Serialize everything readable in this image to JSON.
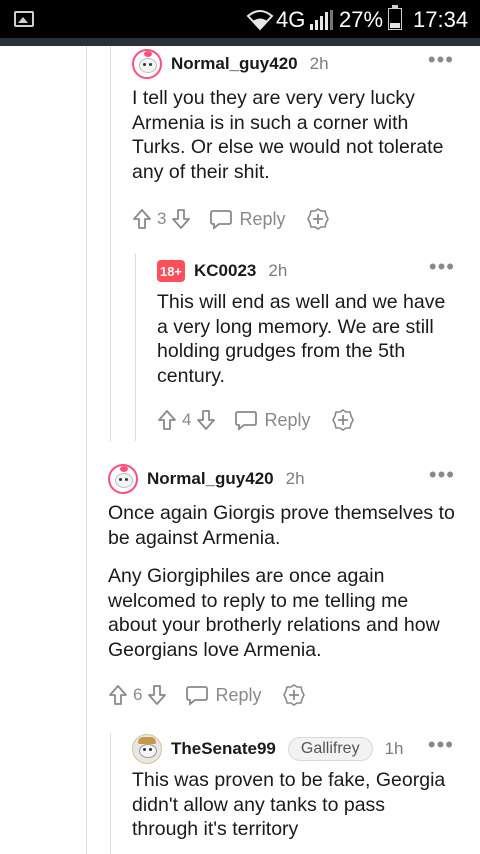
{
  "status_bar": {
    "network": "4G",
    "battery": "27%",
    "battery_level": 0.27,
    "time": "17:34"
  },
  "comments": [
    {
      "username": "Normal_guy420",
      "time": "2h",
      "avatar": "snoo-avatar",
      "paragraphs": [
        "I tell you they are very very lucky Armenia is in such a corner with Turks. Or else we would not tolerate any of their shit."
      ],
      "votes": "3",
      "reply_label": "Reply"
    },
    {
      "username": "KC0023",
      "time": "2h",
      "avatar": "nsfw-18-badge",
      "badge": "18+",
      "paragraphs": [
        "This will end as well and we have a very long memory. We are still holding grudges from the 5th century."
      ],
      "votes": "4",
      "reply_label": "Reply"
    },
    {
      "username": "Normal_guy420",
      "time": "2h",
      "avatar": "snoo-avatar",
      "paragraphs": [
        "Once again Giorgis prove themselves to be against Armenia.",
        "Any Giorgiphiles are once again welcomed to reply to me telling me about your brotherly relations and how Georgians love Armenia."
      ],
      "votes": "6",
      "reply_label": "Reply"
    },
    {
      "username": "TheSenate99",
      "flair": "Gallifrey",
      "time": "1h",
      "avatar": "senate-avatar",
      "paragraphs": [
        "This was proven to be fake, Georgia didn't allow any tanks to pass through it's territory"
      ]
    }
  ],
  "icons": {
    "more": "more-options-icon",
    "upvote": "upvote-arrow-icon",
    "downvote": "downvote-arrow-icon",
    "reply": "reply-bubble-icon",
    "award": "award-plus-icon"
  },
  "colors": {
    "text": "#1a1a1b",
    "meta": "#7c7c7c",
    "icon": "#878a8c",
    "nsfw": "#ff4f5a",
    "threadline": "#dddddd"
  }
}
